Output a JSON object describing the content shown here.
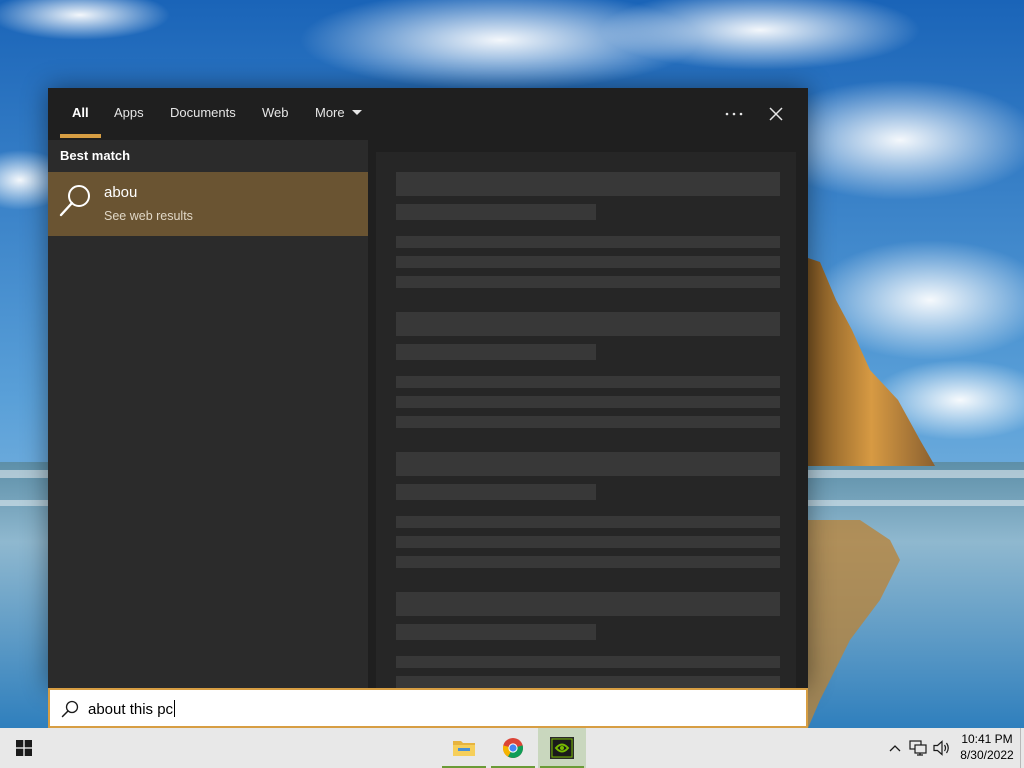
{
  "search_panel": {
    "tabs": [
      {
        "label": "All",
        "active": true
      },
      {
        "label": "Apps"
      },
      {
        "label": "Documents"
      },
      {
        "label": "Web"
      },
      {
        "label": "More",
        "dropdown": true
      }
    ],
    "more_options_icon": "ellipsis-icon",
    "close_icon": "close-icon",
    "best_match": {
      "heading": "Best match",
      "title": "abou",
      "subtitle": "See web results",
      "icon": "search-icon"
    },
    "preview_state": "loading"
  },
  "search_box": {
    "value": "about this pc",
    "icon": "search-icon"
  },
  "taskbar": {
    "start_icon": "windows-logo-icon",
    "pinned_apps": [
      {
        "name": "File Explorer",
        "icon": "file-explorer-icon",
        "running": true
      },
      {
        "name": "Google Chrome",
        "icon": "chrome-icon",
        "running": true
      },
      {
        "name": "NVIDIA",
        "icon": "nvidia-icon",
        "running": true,
        "active": true
      }
    ],
    "tray": {
      "icons": [
        "chevron-up-icon",
        "network-icon",
        "volume-icon"
      ],
      "time": "10:41 PM",
      "date": "8/30/2022"
    }
  },
  "colors": {
    "accent": "#d79e43",
    "best_match_highlight": "#6a5432",
    "panel_background": "#2b2b2b",
    "tab_bar_background": "#1f1f1f",
    "taskbar_background": "#e8e8e8"
  }
}
